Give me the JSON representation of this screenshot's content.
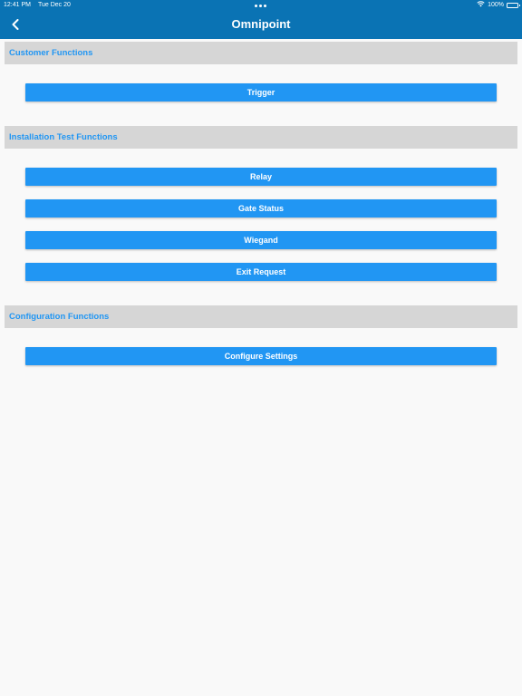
{
  "status_bar": {
    "time": "12:41 PM",
    "date": "Tue Dec 20",
    "battery": "100%",
    "battery_level": 1.0
  },
  "nav": {
    "title": "Omnipoint",
    "back_icon": "chevron-left-icon"
  },
  "sections": [
    {
      "title": "Customer Functions",
      "buttons": [
        "Trigger"
      ]
    },
    {
      "title": "Installation Test Functions",
      "buttons": [
        "Relay",
        "Gate Status",
        "Wiegand",
        "Exit Request"
      ]
    },
    {
      "title": "Configuration Functions",
      "buttons": [
        "Configure Settings"
      ]
    }
  ],
  "colors": {
    "nav_bar": "#0a73b4",
    "accent": "#2196f3",
    "section_bg": "#d6d6d6",
    "page_bg": "#f9f9f9"
  }
}
